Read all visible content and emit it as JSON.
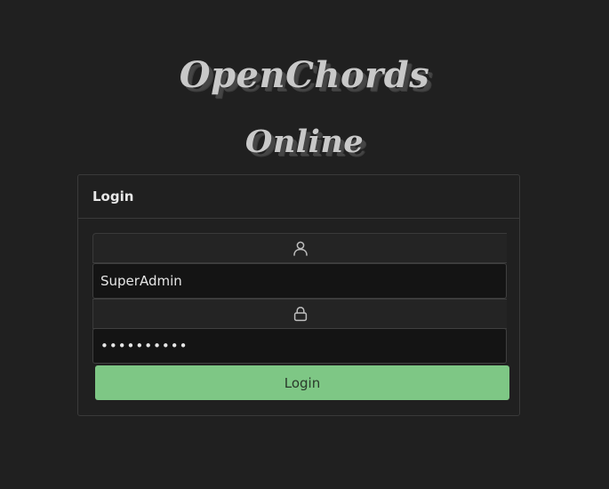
{
  "brand": {
    "line1": "OpenChords",
    "line2": "Online"
  },
  "login_card": {
    "title": "Login",
    "username": {
      "icon": "user-icon",
      "value": "SuperAdmin"
    },
    "password": {
      "icon": "lock-icon",
      "value": "••••••••••"
    },
    "submit_label": "Login"
  },
  "colors": {
    "background": "#202020",
    "brand_text": "#c9c9c9",
    "button": "#7ec785",
    "input_bg": "#141414",
    "border": "#3a3a3a"
  }
}
